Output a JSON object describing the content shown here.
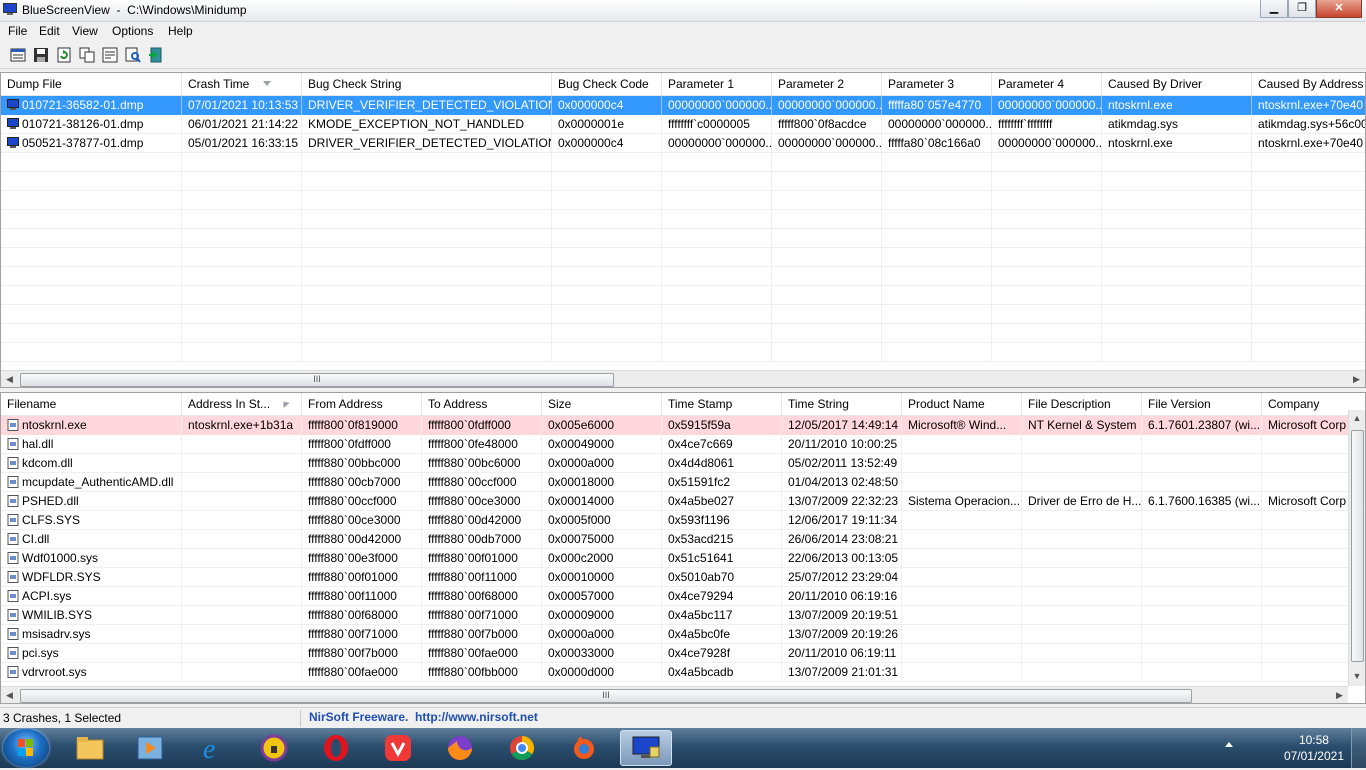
{
  "window": {
    "title": "BlueScreenView  -  C:\\Windows\\Minidump",
    "minimize": "▁",
    "maximize": "❐",
    "close": "✕"
  },
  "menu": [
    "File",
    "Edit",
    "View",
    "Options",
    "Help"
  ],
  "toolbar_icons": [
    "html-report-icon",
    "save-icon",
    "refresh-icon",
    "copy-icon",
    "properties-icon",
    "find-icon",
    "exit-icon"
  ],
  "crash_list": {
    "columns": [
      "Dump File",
      "Crash Time",
      "Bug Check String",
      "Bug Check Code",
      "Parameter 1",
      "Parameter 2",
      "Parameter 3",
      "Parameter 4",
      "Caused By Driver",
      "Caused By Address"
    ],
    "rows": [
      [
        "010721-36582-01.dmp",
        "07/01/2021 10:13:53",
        "DRIVER_VERIFIER_DETECTED_VIOLATION",
        "0x000000c4",
        "00000000`000000...",
        "00000000`000000...",
        "fffffa80`057e4770",
        "00000000`000000...",
        "ntoskrnl.exe",
        "ntoskrnl.exe+70e40"
      ],
      [
        "010721-38126-01.dmp",
        "06/01/2021 21:14:22",
        "KMODE_EXCEPTION_NOT_HANDLED",
        "0x0000001e",
        "ffffffff`c0000005",
        "fffff800`0f8acdce",
        "00000000`000000...",
        "ffffffff`ffffffff",
        "atikmdag.sys",
        "atikmdag.sys+56c00"
      ],
      [
        "050521-37877-01.dmp",
        "05/01/2021 16:33:15",
        "DRIVER_VERIFIER_DETECTED_VIOLATION",
        "0x000000c4",
        "00000000`000000...",
        "00000000`000000...",
        "fffffa80`08c166a0",
        "00000000`000000...",
        "ntoskrnl.exe",
        "ntoskrnl.exe+70e40"
      ]
    ],
    "selected_row": 0
  },
  "driver_list": {
    "columns": [
      "Filename",
      "Address In St...",
      "From Address",
      "To Address",
      "Size",
      "Time Stamp",
      "Time String",
      "Product Name",
      "File Description",
      "File Version",
      "Company"
    ],
    "rows": [
      [
        "ntoskrnl.exe",
        "ntoskrnl.exe+1b31a",
        "fffff800`0f819000",
        "fffff800`0fdff000",
        "0x005e6000",
        "0x5915f59a",
        "12/05/2017 14:49:14",
        "Microsoft® Wind...",
        "NT Kernel & System",
        "6.1.7601.23807 (wi...",
        "Microsoft Corp"
      ],
      [
        "hal.dll",
        "",
        "fffff800`0fdff000",
        "fffff800`0fe48000",
        "0x00049000",
        "0x4ce7c669",
        "20/11/2010 10:00:25",
        "",
        "",
        "",
        ""
      ],
      [
        "kdcom.dll",
        "",
        "fffff880`00bbc000",
        "fffff880`00bc6000",
        "0x0000a000",
        "0x4d4d8061",
        "05/02/2011 13:52:49",
        "",
        "",
        "",
        ""
      ],
      [
        "mcupdate_AuthenticAMD.dll",
        "",
        "fffff880`00cb7000",
        "fffff880`00ccf000",
        "0x00018000",
        "0x51591fc2",
        "01/04/2013 02:48:50",
        "",
        "",
        "",
        ""
      ],
      [
        "PSHED.dll",
        "",
        "fffff880`00ccf000",
        "fffff880`00ce3000",
        "0x00014000",
        "0x4a5be027",
        "13/07/2009 22:32:23",
        "Sistema Operacion...",
        "Driver de Erro de H...",
        "6.1.7600.16385 (wi...",
        "Microsoft Corp"
      ],
      [
        "CLFS.SYS",
        "",
        "fffff880`00ce3000",
        "fffff880`00d42000",
        "0x0005f000",
        "0x593f1196",
        "12/06/2017 19:11:34",
        "",
        "",
        "",
        ""
      ],
      [
        "CI.dll",
        "",
        "fffff880`00d42000",
        "fffff880`00db7000",
        "0x00075000",
        "0x53acd215",
        "26/06/2014 23:08:21",
        "",
        "",
        "",
        ""
      ],
      [
        "Wdf01000.sys",
        "",
        "fffff880`00e3f000",
        "fffff880`00f01000",
        "0x000c2000",
        "0x51c51641",
        "22/06/2013 00:13:05",
        "",
        "",
        "",
        ""
      ],
      [
        "WDFLDR.SYS",
        "",
        "fffff880`00f01000",
        "fffff880`00f11000",
        "0x00010000",
        "0x5010ab70",
        "25/07/2012 23:29:04",
        "",
        "",
        "",
        ""
      ],
      [
        "ACPI.sys",
        "",
        "fffff880`00f11000",
        "fffff880`00f68000",
        "0x00057000",
        "0x4ce79294",
        "20/11/2010 06:19:16",
        "",
        "",
        "",
        ""
      ],
      [
        "WMILIB.SYS",
        "",
        "fffff880`00f68000",
        "fffff880`00f71000",
        "0x00009000",
        "0x4a5bc117",
        "13/07/2009 20:19:51",
        "",
        "",
        "",
        ""
      ],
      [
        "msisadrv.sys",
        "",
        "fffff880`00f71000",
        "fffff880`00f7b000",
        "0x0000a000",
        "0x4a5bc0fe",
        "13/07/2009 20:19:26",
        "",
        "",
        "",
        ""
      ],
      [
        "pci.sys",
        "",
        "fffff880`00f7b000",
        "fffff880`00fae000",
        "0x00033000",
        "0x4ce7928f",
        "20/11/2010 06:19:11",
        "",
        "",
        "",
        ""
      ],
      [
        "vdrvroot.sys",
        "",
        "fffff880`00fae000",
        "fffff880`00fbb000",
        "0x0000d000",
        "0x4a5bcadb",
        "13/07/2009 21:01:31",
        "",
        "",
        "",
        ""
      ]
    ],
    "highlighted_row": 0
  },
  "status": {
    "left": "3 Crashes, 1 Selected",
    "link": "NirSoft Freeware.  http://www.nirsoft.net"
  },
  "taskbar": {
    "apps": [
      "file-explorer",
      "media-player",
      "internet-explorer",
      "tor-browser",
      "opera",
      "vivaldi",
      "firefox",
      "chrome",
      "firefox-nightly",
      "bluescreenview"
    ],
    "time": "10:58",
    "date": "07/01/2021"
  },
  "colors": {
    "selection": "#3399ff",
    "highlight_row": "#ffd7dd",
    "link": "#1f4fb0"
  }
}
